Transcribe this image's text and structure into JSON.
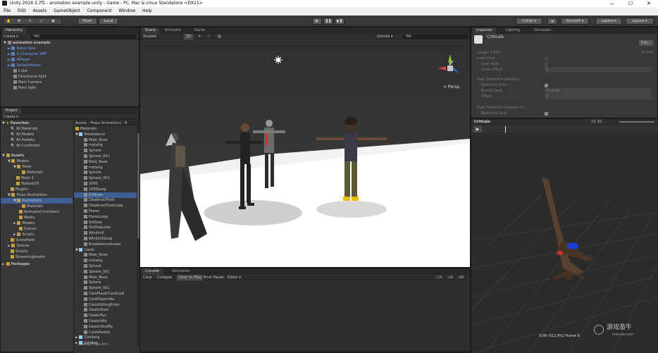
{
  "window": {
    "title": "Unity 2018.3.7f1 - animation example.unity - Game - PC, Mac & Linux Standalone <DX11>",
    "minimize": "—",
    "maximize": "☐",
    "close": "✕"
  },
  "menu": [
    "File",
    "Edit",
    "Assets",
    "GameObject",
    "Component",
    "Window",
    "Help"
  ],
  "toolbar": {
    "pivot": "Pivot",
    "local": "Local",
    "collab": "Collab ▾",
    "account": "Account ▾",
    "layers": "Layers ▾",
    "layout": "Layout ▾"
  },
  "hierarchy": {
    "tab": "Hierarchy",
    "create": "Create ▾",
    "search": "*All",
    "scene": "animation example",
    "items": [
      "Robot Kyle",
      "U_Character_REF",
      "HPlayer",
      "DefaultAvatar",
      "Cube",
      "Directional light",
      "Main Camera",
      "Point light"
    ]
  },
  "project": {
    "tab": "Project",
    "create": "Create ▾",
    "favorites": {
      "title": "Favorites",
      "items": [
        "All Materials",
        "All Models",
        "All Prefabs",
        "All Conflicted"
      ]
    },
    "tree": [
      "Assets",
      "Models",
      "Mesh",
      "Materials",
      "Mesh 1",
      "Texture2D",
      "Plugins",
      "Props Animations",
      "Animations",
      "Materials",
      "AnimatorControllers",
      "Meshs",
      "Models",
      "Scenes",
      "Scripts",
      "SceneFade",
      "Scenes",
      "Scripts",
      "StreamingAssets"
    ],
    "packages": "Packages",
    "breadcrumb": "Assets › Props Animations › A",
    "files": [
      "Materials",
      "Breakdance",
      "Male_Base",
      "metarig",
      "Sphere",
      "Sphere_001",
      "Male_Base",
      "metarig",
      "Sphere",
      "Sphere_001",
      "2000",
      "2000Loop",
      "Criticals",
      "DeadmanFloat",
      "DeadmanFloatLoop",
      "Flares",
      "FlaresLoop",
      "SixStep",
      "SixStepLoop",
      "Windmill",
      "WindmillLoop",
      "BreakdanceAvatar",
      "Cards",
      "Male_Base",
      "metarig",
      "Sphere",
      "Sphere_001",
      "Male_Base",
      "Sphere",
      "Sphere_001",
      "CardPlayerCardLook",
      "CardPlayerIdle",
      "CardsSittingEnter",
      "DealerDeal",
      "DealerFan",
      "DealerIdle",
      "DealerShuffle",
      "CardsAvatar",
      "Climbing",
      "Combat"
    ],
    "footer": "Assets/Props Ani..."
  },
  "scene": {
    "tabs": [
      "Scene",
      "Animator",
      "Game"
    ],
    "shaded": "Shaded",
    "mode2d": "2D",
    "gizmos": "Gizmos ▾",
    "search": "*All",
    "persp": "< Persp"
  },
  "console": {
    "tabs": [
      "Console",
      "Animation"
    ],
    "buttons": [
      "Clear",
      "Collapse",
      "Clear on Play",
      "Error Pause",
      "Editor ▾"
    ],
    "counts": [
      "0",
      "0",
      "0"
    ]
  },
  "inspector": {
    "tabs": [
      "Inspector",
      "Lighting",
      "Occlusion"
    ],
    "name": "Criticals",
    "edit": "Edit...",
    "fields": [
      {
        "label": "Length",
        "value": "0.600"
      },
      {
        "label": "Loop Time",
        "value": ""
      },
      {
        "label": "Loop Pose",
        "value": ""
      },
      {
        "label": "Cycle Offset",
        "value": "0"
      }
    ],
    "fps": "24 FPS",
    "rot_title": "Root Transform Rotation",
    "rot_fields": [
      {
        "label": "Bake Into Pose",
        "value": ""
      },
      {
        "label": "Based Upon",
        "value": "Original"
      },
      {
        "label": "Offset",
        "value": "0"
      }
    ],
    "pos_title": "Root Transform Position (Y)",
    "pos_fields": [
      {
        "label": "Bake Into Pose",
        "value": ""
      }
    ]
  },
  "preview": {
    "title": "Criticals",
    "controls": "1X  2D",
    "status": "0:09 (012.9%) Frame 9",
    "watermark_cn": "游戏蛮牛",
    "watermark_en": "manew.com"
  },
  "colors": {
    "selection": "#3e5f96",
    "panel": "#383838",
    "scene_sky": "#2f2f2f",
    "scene_floor": "#ffffff",
    "preview_bg": "#2b2b2b"
  }
}
